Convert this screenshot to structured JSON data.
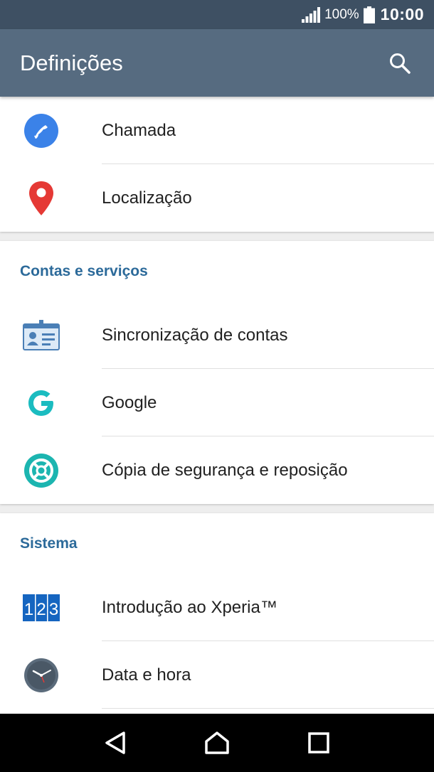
{
  "status_bar": {
    "battery_percent": "100%",
    "time": "10:00"
  },
  "app_bar": {
    "title": "Definições"
  },
  "sections": [
    {
      "header": "",
      "items": [
        {
          "label": "Chamada",
          "icon": "phone-icon"
        },
        {
          "label": "Localização",
          "icon": "location-pin-icon"
        }
      ]
    },
    {
      "header": "Contas e serviços",
      "items": [
        {
          "label": "Sincronização de contas",
          "icon": "account-sync-icon"
        },
        {
          "label": "Google",
          "icon": "google-icon"
        },
        {
          "label": "Cópia de segurança e reposição",
          "icon": "backup-restore-icon"
        }
      ]
    },
    {
      "header": "Sistema",
      "items": [
        {
          "label": "Introdução ao Xperia™",
          "icon": "xperia-intro-icon"
        },
        {
          "label": "Data e hora",
          "icon": "clock-icon"
        }
      ]
    }
  ],
  "colors": {
    "status_bar": "#3e5063",
    "app_bar": "#566b80",
    "section_header": "#2c6a9a"
  }
}
